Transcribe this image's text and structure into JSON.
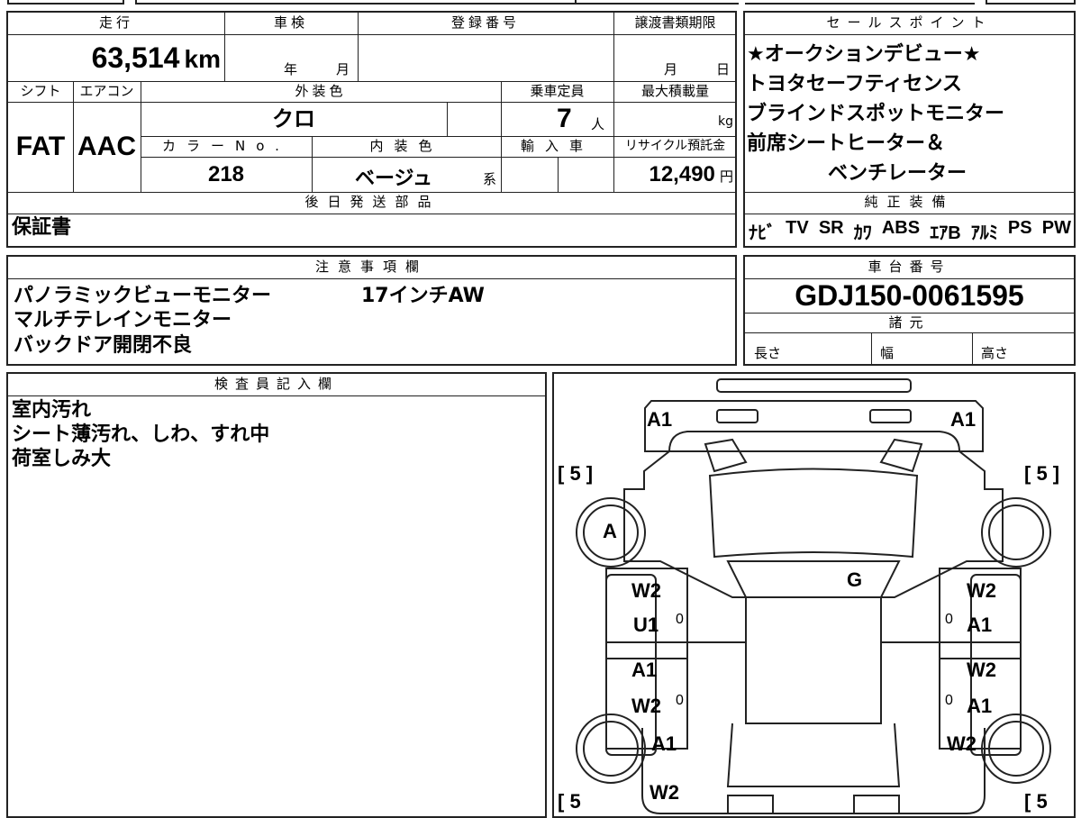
{
  "top": {
    "mileage_label": "走行",
    "mileage_value": "63,514",
    "mileage_unit": "km",
    "shaken_label": "車検",
    "shaken_year_unit": "年",
    "shaken_month_unit": "月",
    "reg_label": "登録番号",
    "transfer_label": "譲渡書類期限",
    "transfer_month_unit": "月",
    "transfer_day_unit": "日",
    "shift_label": "シフト",
    "ac_label": "エアコン",
    "exterior_label": "外装色",
    "capacity_label": "乗車定員",
    "maxload_label": "最大積載量",
    "shift_value": "FAT",
    "ac_value": "AAC",
    "exterior_value": "クロ",
    "capacity_value": "7",
    "capacity_unit": "人",
    "maxload_unit": "kg",
    "colorno_label": "カラーNo.",
    "interior_label": "内装色",
    "import_label": "輸入車",
    "recycle_label": "リサイクル預託金",
    "colorno_value": "218",
    "interior_value": "ベージュ",
    "interior_suffix": "系",
    "recycle_value": "12,490",
    "recycle_unit": "円",
    "later_parts_label": "後日発送部品",
    "later_parts_value": "保証書"
  },
  "sales": {
    "label": "セールスポイント",
    "lines": [
      "★オークションデビュー★",
      "トヨタセーフティセンス",
      "ブラインドスポットモニター",
      "前席シートヒーター＆",
      "ベンチレーター"
    ],
    "equip_label": "純正装備",
    "equip_items": [
      "ﾅﾋﾞ",
      "TV",
      "SR",
      "ｶﾜ",
      "ABS",
      "ｴｱB",
      "ｱﾙﾐ",
      "PS",
      "PW"
    ]
  },
  "notes": {
    "label": "注意事項欄",
    "lines": [
      "パノラミックビューモニター",
      "マルチテレインモニター",
      "バックドア開閉不良"
    ],
    "extra": "17インチAW"
  },
  "chassis": {
    "label": "車台番号",
    "value": "GDJ150-0061595",
    "spec_label": "諸元",
    "length_label": "長さ",
    "width_label": "幅",
    "height_label": "高さ"
  },
  "inspector": {
    "label": "検査員記入欄",
    "lines": [
      "室内汚れ",
      "シート薄汚れ、しわ、すれ中",
      "荷室しみ大"
    ]
  },
  "diagram": {
    "marks": {
      "a1_tl": "A1",
      "a1_tr": "A1",
      "b5_tl": "[ 5 ]",
      "b5_tr": "[ 5 ]",
      "b5_bl": "[ 5",
      "b5_br": "[ 5",
      "a_circle": "A",
      "g": "G",
      "l_w2_1": "W2",
      "l_u1": "U1",
      "l_0_1": "0",
      "l_a1_2": "A1",
      "l_w2_2": "W2",
      "l_0_2": "0",
      "l_a1_3": "A1",
      "l_w2_3": "W2",
      "r_w2_1": "W2",
      "r_0_1": "0",
      "r_a1_1": "A1",
      "r_w2_2": "W2",
      "r_0_2": "0",
      "r_a1_2": "A1",
      "r_w2_3": "W2"
    }
  }
}
